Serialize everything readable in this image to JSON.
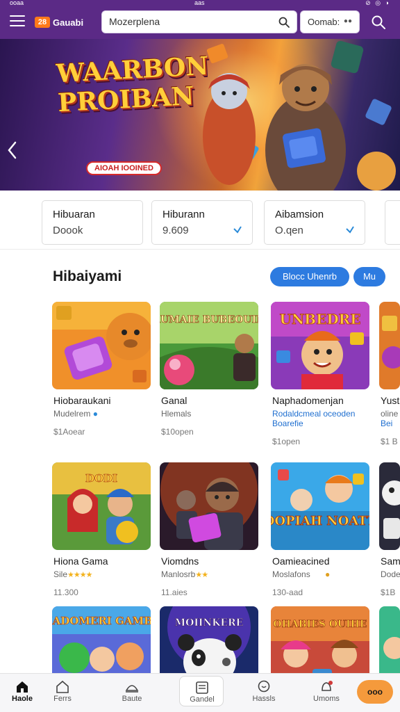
{
  "status_bar": {
    "left": "ooaa",
    "center": "aas",
    "right": "⊘ ◎ ◑"
  },
  "header": {
    "logo_mark": "28",
    "logo_text": "Gauabi",
    "search_value": "Mozerplena",
    "select_value": "Oomab:",
    "icons": {
      "menu": "hamburger-menu-icon",
      "search": "search-icon"
    }
  },
  "hero": {
    "title_line1": "WAARBON",
    "title_line2": "PROIBAN",
    "subtitle": "AIOAH IOOINED",
    "colors": {
      "title": "#ffcf3a",
      "title_shadow": "#b8381a",
      "badge_border": "#d62a2a"
    }
  },
  "stats": [
    {
      "title": "Hibuaran",
      "value": "Doook",
      "check": false
    },
    {
      "title": "Hiburann",
      "value": "9.609",
      "check": true
    },
    {
      "title": "Aibamsion",
      "value": "O.qen",
      "check": true
    }
  ],
  "section": {
    "title": "Hibaiyami",
    "button_primary": "Blocc Uhenrb",
    "button_secondary": "Mu"
  },
  "thumb_texts": {
    "t2": "GAUMAIE BUBEOUING",
    "t3": "UNBEDRE",
    "t5": "DODI",
    "t7": "SIOOPIAH NOATTIE",
    "t9": "HADOMERI GAMBS",
    "t10": "MOIINKERE",
    "t11": "OHABIES OUIHE"
  },
  "games": [
    {
      "name": "Hiobaraukani",
      "meta": "Mudelrem",
      "count": "$1Aoear"
    },
    {
      "name": "Ganal",
      "meta": "Hlemals",
      "count": "$10open"
    },
    {
      "name": "Naphadomenjan",
      "meta": "Rodaldcmeal oceoden",
      "extra": "Boarefie",
      "count": "$1open"
    },
    {
      "name": "Yusta",
      "meta": "oline",
      "extra": "Bei",
      "count": "$1 B"
    },
    {
      "name": "Hiona Gama",
      "meta": "Sile",
      "stars": "★★★★",
      "count": "11.300"
    },
    {
      "name": "Viomdns",
      "meta": "Manlosrb",
      "stars": "★★",
      "count": "11.aies"
    },
    {
      "name": "Oamieacined",
      "meta": "Moslafons",
      "count": "130-aad"
    },
    {
      "name": "Samt",
      "meta": "Dode",
      "count": "$1B"
    }
  ],
  "bottom_nav": [
    {
      "label": "Haole",
      "icon": "home-icon",
      "active": true
    },
    {
      "label": "Ferrs",
      "icon": "house-outline-icon",
      "active": false
    },
    {
      "label": "Baute",
      "icon": "arch-icon",
      "active": false
    },
    {
      "label": "Gandel",
      "icon": "document-icon",
      "active": false,
      "boxed": true
    },
    {
      "label": "Hassls",
      "icon": "chat-bubble-icon",
      "active": false
    },
    {
      "label": "Umoms",
      "icon": "bell-icon",
      "active": false
    }
  ],
  "fab_label": "ooo"
}
